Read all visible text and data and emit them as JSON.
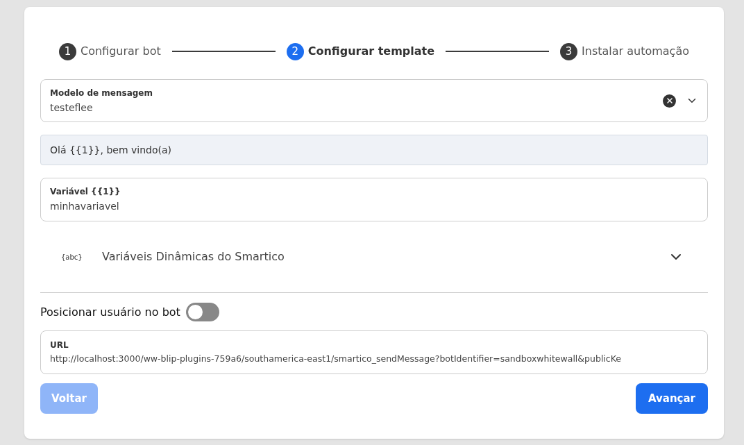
{
  "steps": [
    {
      "number": "1",
      "label": "Configurar bot",
      "selected": false
    },
    {
      "number": "2",
      "label": "Configurar template",
      "selected": true
    },
    {
      "number": "3",
      "label": "Instalar automação",
      "selected": false
    }
  ],
  "template_select": {
    "label": "Modelo de mensagem",
    "value": "testeflee"
  },
  "template_preview": "Olá {{1}}, bem vindo(a)",
  "variable_field": {
    "label": "Variável {{1}}",
    "value": "minhavariavel"
  },
  "accordion": {
    "icon_text": "{abc}",
    "title": "Variáveis Dinâmicas do Smartico",
    "expanded": false
  },
  "position_toggle": {
    "label": "Posicionar usuário no bot",
    "on": false
  },
  "url_field": {
    "label": "URL",
    "value": "http://localhost:3000/ww-blip-plugins-759a6/southamerica-east1/smartico_sendMessage?botIdentifier=sandboxwhitewall&publicKe"
  },
  "buttons": {
    "back": {
      "label": "Voltar",
      "disabled": true
    },
    "next": {
      "label": "Avançar",
      "disabled": false
    }
  }
}
